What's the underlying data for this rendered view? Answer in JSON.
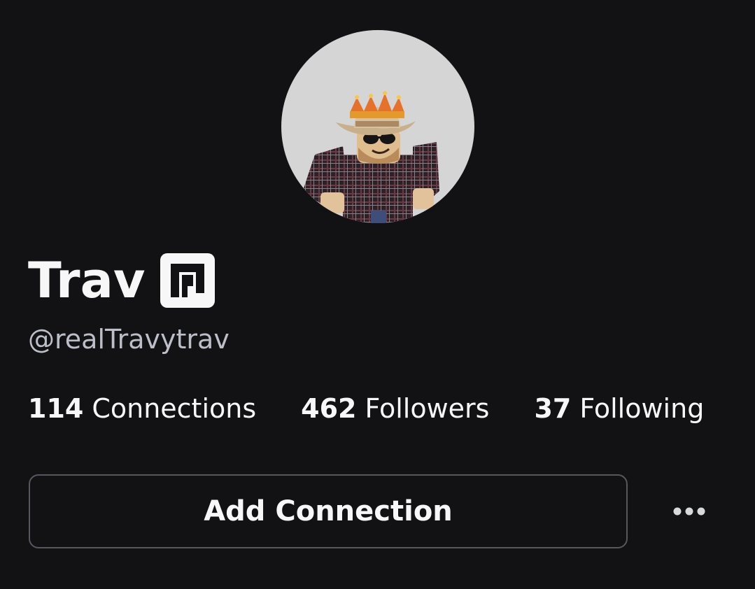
{
  "profile": {
    "display_name": "Trav",
    "username": "@realTravytrav",
    "avatar_icon": "avatar-roblox-character",
    "verified_icon": "premium-badge-icon"
  },
  "stats": [
    {
      "count": "114",
      "label": "Connections"
    },
    {
      "count": "462",
      "label": "Followers"
    },
    {
      "count": "37",
      "label": "Following"
    }
  ],
  "actions": {
    "add_connection_label": "Add Connection",
    "more_icon": "more-horizontal-icon"
  },
  "colors": {
    "background": "#121215",
    "text_primary": "#f7f7f8",
    "text_secondary": "#bcbec8",
    "button_border": "#56585f",
    "avatar_bg": "#d5d5d5"
  }
}
